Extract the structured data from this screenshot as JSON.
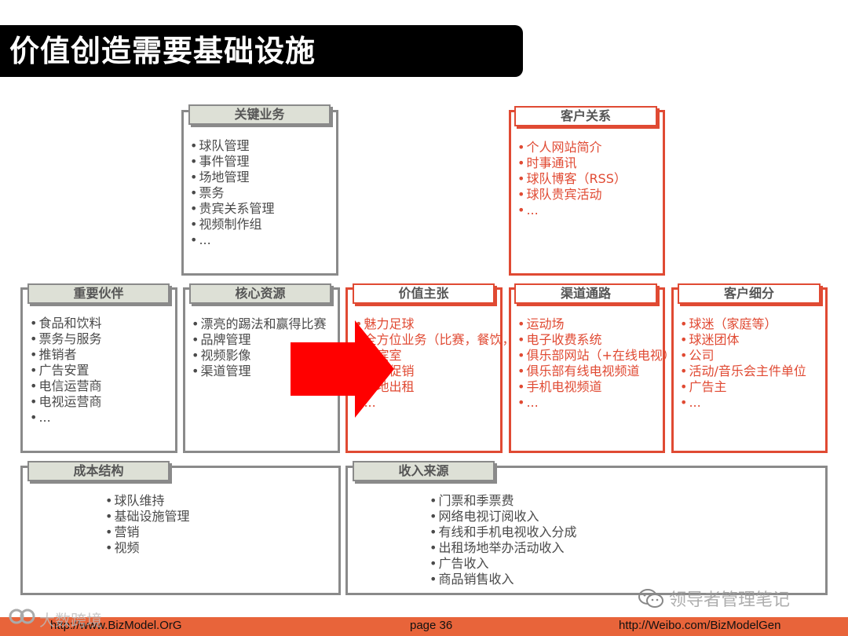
{
  "title": "价值创造需要基础设施",
  "blocks": {
    "key_activities": {
      "label": "关键业务",
      "items": [
        "球队管理",
        "事件管理",
        "场地管理",
        "票务",
        "贵宾关系管理",
        "视频制作组",
        "..."
      ]
    },
    "customer_relationships": {
      "label": "客户关系",
      "items": [
        "个人网站简介",
        "时事通讯",
        "球队博客（RSS）",
        "球队贵宾活动",
        "..."
      ]
    },
    "key_partners": {
      "label": "重要伙伴",
      "items": [
        "食品和饮料",
        "票务与服务",
        "推销者",
        "广告安置",
        "电信运营商",
        "电视运营商",
        "..."
      ]
    },
    "key_resources": {
      "label": "核心资源",
      "items": [
        "漂亮的踢法和赢得比赛",
        "品牌管理",
        "视频影像",
        "渠道管理"
      ]
    },
    "value_propositions": {
      "label": "价值主张",
      "items": [
        "魅力足球",
        "全方位业务（比赛，餐饮，购物）",
        "贵宾室",
        "商品促销",
        "场地出租",
        "..."
      ]
    },
    "channels": {
      "label": "渠道通路",
      "items": [
        "运动场",
        "电子收费系统",
        "俱乐部网站（+在线电视）",
        "俱乐部有线电视频道",
        "手机电视频道",
        "..."
      ]
    },
    "customer_segments": {
      "label": "客户细分",
      "items": [
        "球迷（家庭等）",
        "球迷团体",
        "公司",
        "活动/音乐会主件单位",
        "广告主",
        "..."
      ]
    },
    "cost_structure": {
      "label": "成本结构",
      "items": [
        "球队维持",
        "基础设施管理",
        "营销",
        "视频"
      ]
    },
    "revenue_streams": {
      "label": "收入来源",
      "items": [
        "门票和季票费",
        "网络电视订阅收入",
        "有线和手机电视收入分成",
        "出租场地举办活动收入",
        "广告收入",
        "商品销售收入"
      ]
    }
  },
  "footer": {
    "left": "http://www.BizModel.OrG",
    "center": "page 36",
    "right": "http://Weibo.com/BizModelGen"
  },
  "watermarks": {
    "right": "领导者管理笔记",
    "left": "大数跨境"
  },
  "colors": {
    "accent": "#e04a33",
    "arrow": "#ff0000",
    "footer": "#e8643a",
    "label_bg": "#dde0d6"
  }
}
